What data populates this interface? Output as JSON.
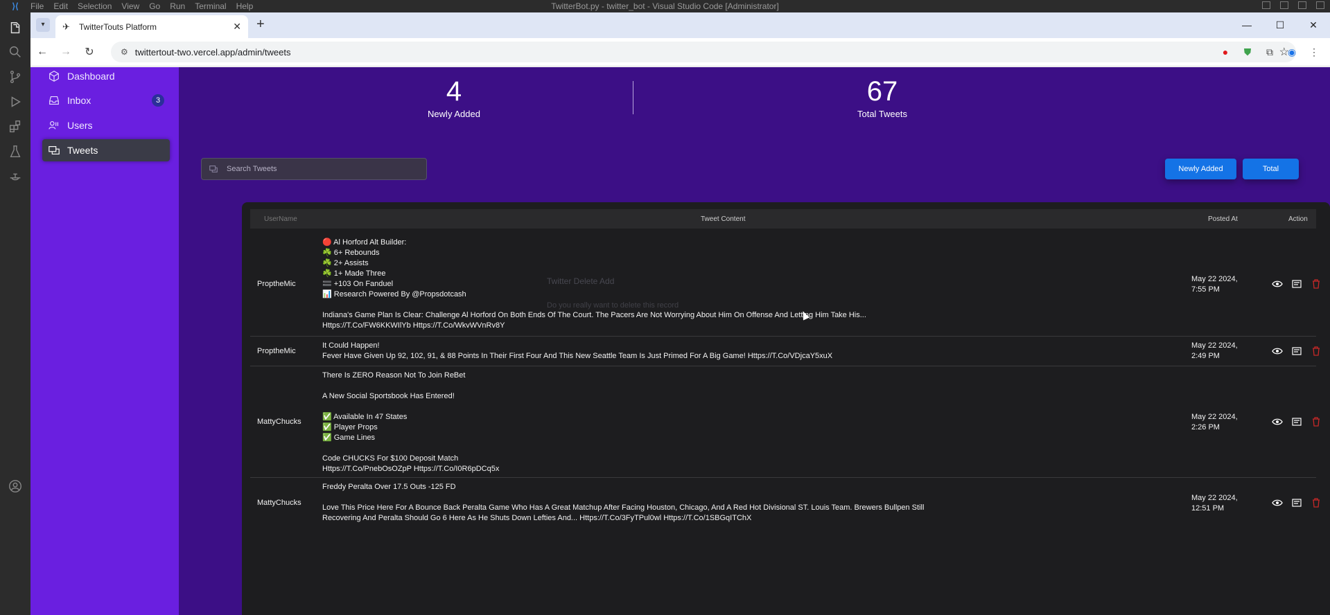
{
  "vscode": {
    "menu": [
      "File",
      "Edit",
      "Selection",
      "View",
      "Go",
      "Run",
      "Terminal",
      "Help"
    ],
    "title": "TwitterBot.py - twitter_bot - Visual Studio Code [Administrator]"
  },
  "browser": {
    "tab_title": "TwitterTouts Platform",
    "url": "twittertout-two.vercel.app/admin/tweets"
  },
  "sidebar": {
    "items": [
      {
        "label": "Dashboard",
        "icon": "dashboard-icon"
      },
      {
        "label": "Inbox",
        "icon": "inbox-icon",
        "badge": "3"
      },
      {
        "label": "Users",
        "icon": "users-icon"
      },
      {
        "label": "Tweets",
        "icon": "tweets-icon",
        "active": true
      }
    ]
  },
  "stats": {
    "new": {
      "value": "4",
      "label": "Newly Added"
    },
    "total": {
      "value": "67",
      "label": "Total Tweets"
    }
  },
  "search": {
    "placeholder": "Search Tweets"
  },
  "filters": {
    "newly_added": "Newly Added",
    "total": "Total"
  },
  "table": {
    "headers": {
      "username": "UserName",
      "content": "Tweet Content",
      "posted": "Posted At",
      "action": "Action"
    },
    "rows": [
      {
        "user": "ProptheMic",
        "content": "🔴 Al Horford Alt Builder:\n☘️ 6+ Rebounds\n☘️ 2+ Assists\n☘️ 1+ Made Three\n🟰 +103 On Fanduel\n📊 Research Powered By @Propsdotcash\n\nIndiana's Game Plan Is Clear: Challenge Al Horford On Both Ends Of The Court. The Pacers Are Not Worrying About Him On Offense And Letting Him Take His...\nHttps://T.Co/FW6KKWIlYb Https://T.Co/WkvWVnRv8Y",
        "posted": "May 22 2024,\n7:55 PM"
      },
      {
        "user": "ProptheMic",
        "content": "It Could Happen!\nFever Have Given Up 92, 102, 91, & 88 Points In Their First Four And This New Seattle Team Is Just Primed For A Big Game! Https://T.Co/VDjcaY5xuX",
        "posted": "May 22 2024,\n2:49 PM"
      },
      {
        "user": "MattyChucks",
        "content": "There Is ZERO Reason Not To Join ReBet\n\nA New Social Sportsbook Has Entered!\n\n✅ Available In 47 States\n✅ Player Props\n✅ Game Lines\n\nCode CHUCKS For $100 Deposit Match\nHttps://T.Co/PnebOsOZpP Https://T.Co/I0R6pDCq5x",
        "posted": "May 22 2024,\n2:26 PM"
      },
      {
        "user": "MattyChucks",
        "content": "Freddy Peralta Over 17.5 Outs -125 FD\n\nLove This Price Here For A Bounce Back Peralta Game Who Has A Great Matchup After Facing Houston, Chicago, And A Red Hot Divisional ST. Louis Team. Brewers Bullpen Still\nRecovering And Peralta Should Go 6 Here As He Shuts Down Lefties And... Https://T.Co/3FyTPul0wl Https://T.Co/1SBGqITChX",
        "posted": "May 22 2024,\n12:51 PM"
      }
    ]
  },
  "ghost_modal": {
    "title": "Twitter Delete Add",
    "text": "Do you really want to delete this record"
  },
  "colors": {
    "sidebar": "#6a1fe0",
    "page": "#3c0f86",
    "accent": "#1473e6",
    "delete": "#c62828"
  }
}
